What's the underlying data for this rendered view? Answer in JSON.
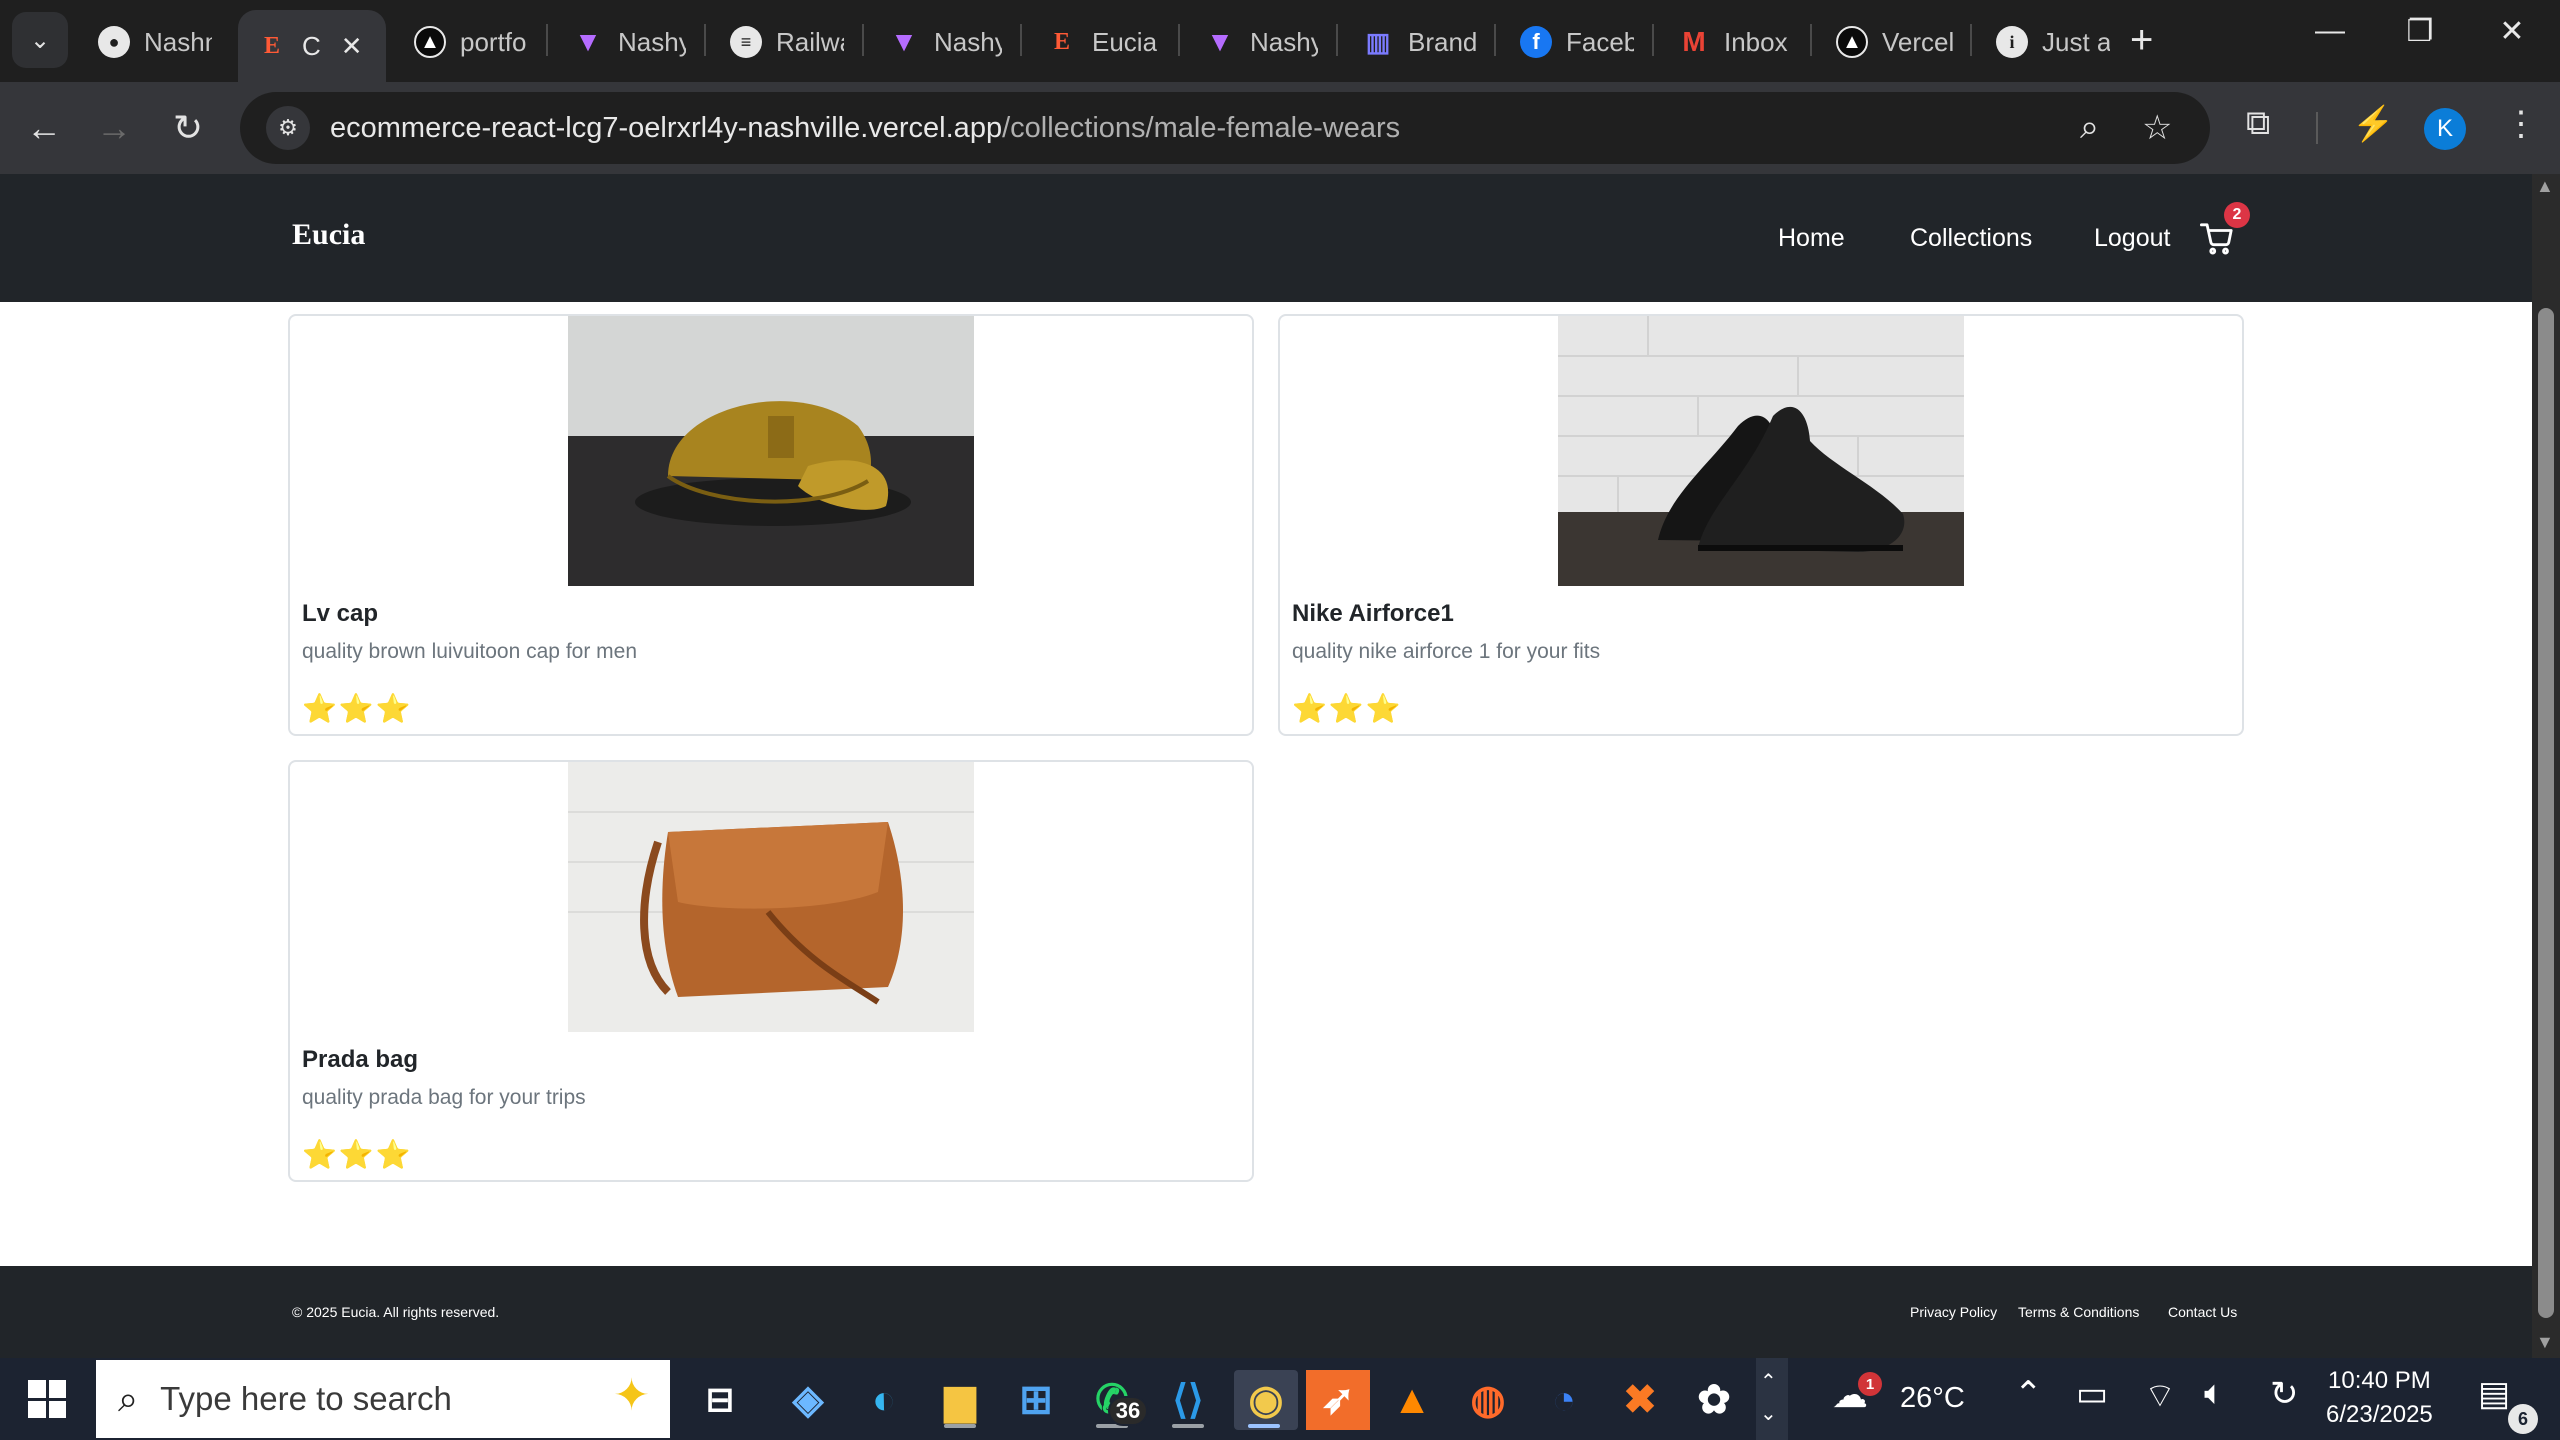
{
  "browser": {
    "tabs": [
      {
        "label": "Nashn",
        "icon": "github-icon"
      },
      {
        "label": "C",
        "icon": "eucia-icon",
        "active": true
      },
      {
        "label": "portfo",
        "icon": "triangle-icon"
      },
      {
        "label": "Nashy",
        "icon": "vite-icon"
      },
      {
        "label": "Railwa",
        "icon": "railway-icon"
      },
      {
        "label": "Nashy",
        "icon": "vite-icon"
      },
      {
        "label": "Eucia",
        "icon": "eucia-icon"
      },
      {
        "label": "Nashy",
        "icon": "vite-icon"
      },
      {
        "label": "Brand",
        "icon": "chart-icon"
      },
      {
        "label": "Faceb",
        "icon": "facebook-icon"
      },
      {
        "label": "Inbox",
        "icon": "gmail-icon"
      },
      {
        "label": "Vercel",
        "icon": "vercel-icon"
      },
      {
        "label": "Just a",
        "icon": "info-icon"
      }
    ],
    "url_host": "ecommerce-react-lcg7-oelrxrl4y-nashville.vercel.app",
    "url_path": "/collections/male-female-wears",
    "profile_initial": "K"
  },
  "site": {
    "brand": "Eucia",
    "nav": {
      "home": "Home",
      "collections": "Collections",
      "logout": "Logout"
    },
    "cart_count": "2",
    "products": [
      {
        "title": "Lv cap",
        "description": "quality brown luivuitoon cap for men",
        "rating": 3,
        "stars": "⭐⭐⭐"
      },
      {
        "title": "Nike Airforce1",
        "description": "quality nike airforce 1 for your fits",
        "rating": 3,
        "stars": "⭐⭐⭐"
      },
      {
        "title": "Prada bag",
        "description": "quality prada bag for your trips",
        "rating": 3,
        "stars": "⭐⭐⭐"
      }
    ],
    "footer": {
      "copyright": "© 2025 Eucia. All rights reserved.",
      "privacy": "Privacy Policy",
      "terms": "Terms & Conditions",
      "contact": "Contact Us"
    }
  },
  "taskbar": {
    "search_placeholder": "Type here to search",
    "whatsapp_badge": "36",
    "weather_badge": "1",
    "temperature": "26°C",
    "time": "10:40 PM",
    "date": "6/23/2025",
    "notification_count": "6"
  }
}
